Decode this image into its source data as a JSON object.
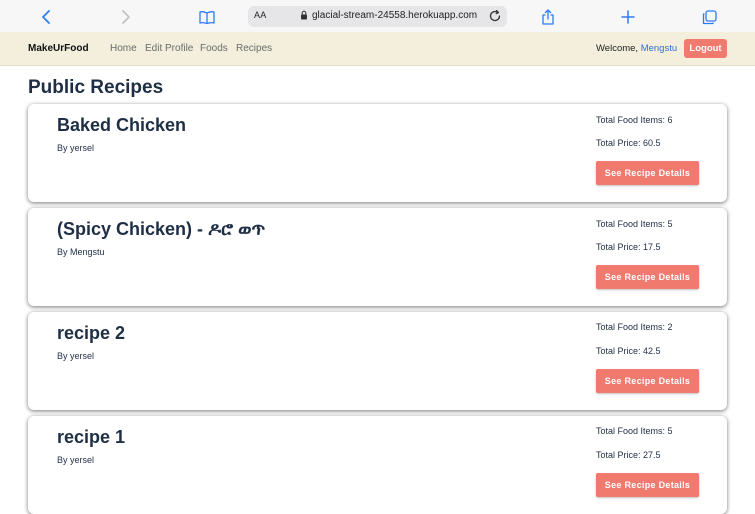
{
  "browser": {
    "text_size_label": "AA",
    "url": "glacial-stream-24558.herokuapp.com"
  },
  "navbar": {
    "brand": "MakeUrFood",
    "links": [
      "Home",
      "Edit Profile",
      "Foods",
      "Recipes"
    ],
    "welcome_prefix": "Welcome,",
    "username": "Mengstu",
    "logout_label": "Logout"
  },
  "page": {
    "title": "Public Recipes"
  },
  "recipes": [
    {
      "title": "Baked Chicken",
      "author": "By yersel",
      "items": "Total Food Items: 6",
      "price": "Total Price: 60.5",
      "button": "See Recipe Details"
    },
    {
      "title": "(Spicy Chicken) - ዶሮ ወጥ",
      "author": "By Mengstu",
      "items": "Total Food Items: 5",
      "price": "Total Price: 17.5",
      "button": "See Recipe Details"
    },
    {
      "title": "recipe 2",
      "author": "By yersel",
      "items": "Total Food Items: 2",
      "price": "Total Price: 42.5",
      "button": "See Recipe Details"
    },
    {
      "title": "recipe 1",
      "author": "By yersel",
      "items": "Total Food Items: 5",
      "price": "Total Price: 27.5",
      "button": "See Recipe Details"
    }
  ],
  "colors": {
    "accent": "#ef7a6d",
    "navbar_bg": "#f3efdc",
    "heading": "#1e2e44",
    "link_blue": "#2f6fd7"
  }
}
